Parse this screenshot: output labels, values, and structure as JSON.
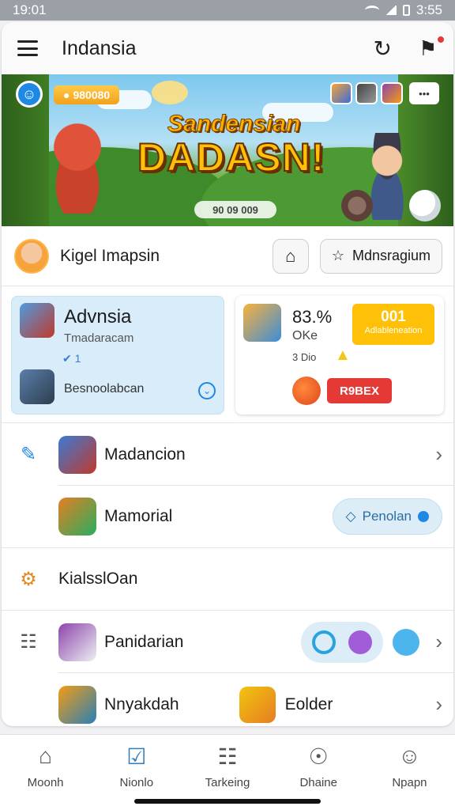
{
  "status_bar": {
    "time": "19:01",
    "right_text": "3:55"
  },
  "app_bar": {
    "title": "Indansia"
  },
  "banner": {
    "coin_value": "980080",
    "headline_top": "Sandensian",
    "headline_main": "DADASN!",
    "bottom_pill": "90 09 009",
    "menu_label": "•••"
  },
  "profile": {
    "name": "Kigel Imapsin",
    "manage_label": "Mdnsragium"
  },
  "tile_a": {
    "title": "Advnsia",
    "subtitle": "Tmadaracam",
    "count": "1",
    "bottom": "Besnoolabcan"
  },
  "tile_b": {
    "percent": "83.%",
    "ok": "OKe",
    "price": "3 Dio",
    "badge_big": "001",
    "badge_small": "Adlableneation",
    "red_button": "R9BEX"
  },
  "list": [
    {
      "label": "Madancion"
    },
    {
      "label": "Mamorial",
      "pill": "Penolan"
    },
    {
      "label": "KialsslOan"
    },
    {
      "label": "Panidarian"
    },
    {
      "label": "Nnyakdah",
      "second_label": "Eolder"
    }
  ],
  "bottom_nav": [
    {
      "label": "Moonh",
      "icon": "home-icon"
    },
    {
      "label": "Nionlo",
      "icon": "checkbox-icon"
    },
    {
      "label": "Tarkeing",
      "icon": "clipboard-icon"
    },
    {
      "label": "Dhaine",
      "icon": "search-icon"
    },
    {
      "label": "Npapn",
      "icon": "person-icon"
    }
  ],
  "colors": {
    "accent": "#1e88e5",
    "badge": "#ffc107",
    "danger": "#e53935"
  }
}
